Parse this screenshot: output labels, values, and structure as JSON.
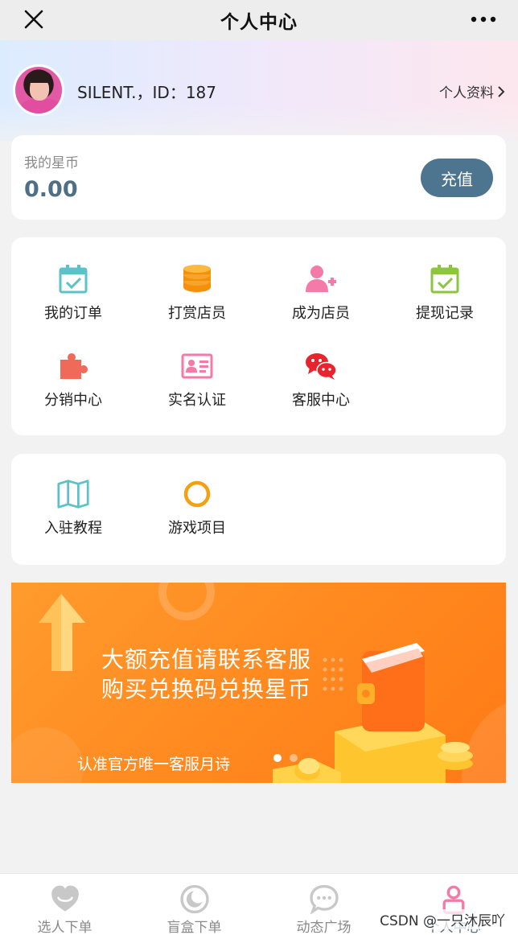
{
  "header": {
    "title": "个人中心",
    "close_icon": "close-icon",
    "more_icon": "more-icon"
  },
  "user": {
    "name_id": "SILENT.，ID：187",
    "profile_link": "个人资料"
  },
  "wallet": {
    "label": "我的星币",
    "value": "0.00",
    "recharge_label": "充值",
    "accent": "#4e7590"
  },
  "menu": {
    "items": [
      {
        "label": "我的订单",
        "icon": "calendar-check-icon"
      },
      {
        "label": "打赏店员",
        "icon": "coins-icon"
      },
      {
        "label": "成为店员",
        "icon": "user-plus-icon"
      },
      {
        "label": "提现记录",
        "icon": "calendar-check-green-icon"
      },
      {
        "label": "分销中心",
        "icon": "puzzle-icon"
      },
      {
        "label": "实名认证",
        "icon": "id-card-icon"
      },
      {
        "label": "客服中心",
        "icon": "chat-icon"
      }
    ]
  },
  "menu2": {
    "items": [
      {
        "label": "入驻教程",
        "icon": "map-icon"
      },
      {
        "label": "游戏项目",
        "icon": "ring-icon"
      }
    ]
  },
  "banner": {
    "line1": "大额充值请联系客服",
    "line2": "购买兑换码兑换星币",
    "line3": "认准官方唯一客服月诗"
  },
  "tabbar": {
    "items": [
      {
        "label": "选人下单",
        "icon": "heart-face-icon"
      },
      {
        "label": "盲盒下单",
        "icon": "moon-icon"
      },
      {
        "label": "动态广场",
        "icon": "chat-bubble-icon"
      },
      {
        "label": "个人中心",
        "icon": "person-icon"
      }
    ]
  },
  "watermark": "CSDN @一只沐辰吖"
}
